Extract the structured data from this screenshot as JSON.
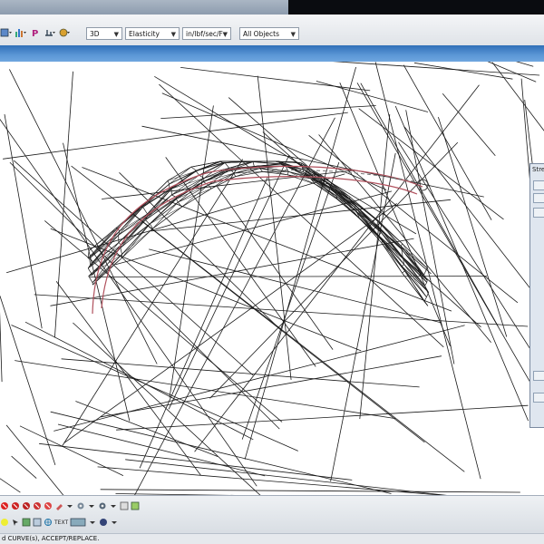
{
  "toolbar": {
    "view_value": "3D",
    "analysis_value": "Elasticity",
    "units_value": "in/lbf/sec/F",
    "filter_value": "All Objects",
    "pen_label": "P"
  },
  "panel": {
    "title": "Stre"
  },
  "bottom": {
    "text_label": "TEXT"
  },
  "status": {
    "message": "d CURVE(s), ACCEPT/REPLACE."
  },
  "colors": {
    "mesh": "#1a1a1a",
    "curve": "#b0505c",
    "accent_band": "#4a88cc"
  }
}
